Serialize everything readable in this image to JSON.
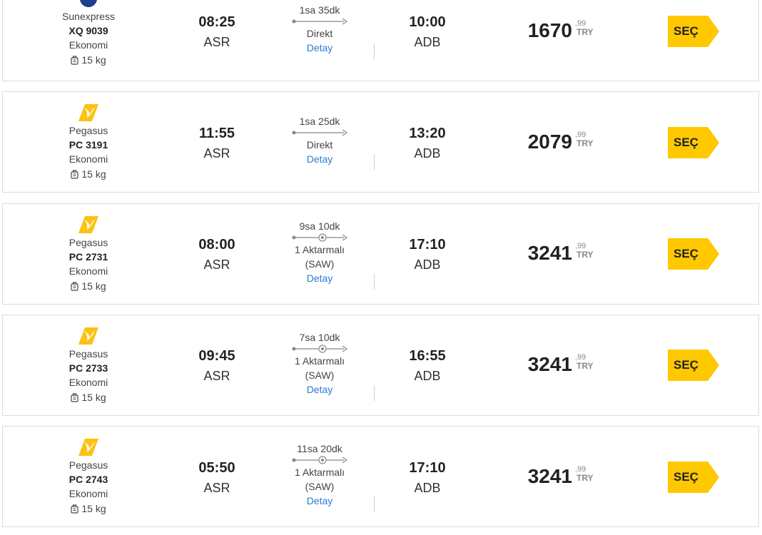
{
  "colors": {
    "accent": "#ffc800",
    "link": "#2b7ad6",
    "border": "#dcdcdc"
  },
  "flights": [
    {
      "airline": "Sunexpress",
      "logo_icon": "sunexpress-logo-icon",
      "flight_no": "XQ 9039",
      "cabin": "Ekonomi",
      "baggage": "15 kg",
      "dep_time": "08:25",
      "dep_airport": "ASR",
      "duration": "1sa 35dk",
      "stop_text": "Direkt",
      "stop_airport": "",
      "detail_label": "Detay",
      "arr_time": "10:00",
      "arr_airport": "ADB",
      "price_int": "1670",
      "price_frac": ",99",
      "currency": "TRY",
      "select_label": "SEÇ"
    },
    {
      "airline": "Pegasus",
      "logo_icon": "pegasus-logo-icon",
      "flight_no": "PC 3191",
      "cabin": "Ekonomi",
      "baggage": "15 kg",
      "dep_time": "11:55",
      "dep_airport": "ASR",
      "duration": "1sa 25dk",
      "stop_text": "Direkt",
      "stop_airport": "",
      "detail_label": "Detay",
      "arr_time": "13:20",
      "arr_airport": "ADB",
      "price_int": "2079",
      "price_frac": ",99",
      "currency": "TRY",
      "select_label": "SEÇ"
    },
    {
      "airline": "Pegasus",
      "logo_icon": "pegasus-logo-icon",
      "flight_no": "PC 2731",
      "cabin": "Ekonomi",
      "baggage": "15 kg",
      "dep_time": "08:00",
      "dep_airport": "ASR",
      "duration": "9sa 10dk",
      "stop_text": "1 Aktarmalı",
      "stop_airport": "(SAW)",
      "detail_label": "Detay",
      "arr_time": "17:10",
      "arr_airport": "ADB",
      "price_int": "3241",
      "price_frac": ",99",
      "currency": "TRY",
      "select_label": "SEÇ"
    },
    {
      "airline": "Pegasus",
      "logo_icon": "pegasus-logo-icon",
      "flight_no": "PC 2733",
      "cabin": "Ekonomi",
      "baggage": "15 kg",
      "dep_time": "09:45",
      "dep_airport": "ASR",
      "duration": "7sa 10dk",
      "stop_text": "1 Aktarmalı",
      "stop_airport": "(SAW)",
      "detail_label": "Detay",
      "arr_time": "16:55",
      "arr_airport": "ADB",
      "price_int": "3241",
      "price_frac": ",99",
      "currency": "TRY",
      "select_label": "SEÇ"
    },
    {
      "airline": "Pegasus",
      "logo_icon": "pegasus-logo-icon",
      "flight_no": "PC 2743",
      "cabin": "Ekonomi",
      "baggage": "15 kg",
      "dep_time": "05:50",
      "dep_airport": "ASR",
      "duration": "11sa 20dk",
      "stop_text": "1 Aktarmalı",
      "stop_airport": "(SAW)",
      "detail_label": "Detay",
      "arr_time": "17:10",
      "arr_airport": "ADB",
      "price_int": "3241",
      "price_frac": ",99",
      "currency": "TRY",
      "select_label": "SEÇ"
    }
  ]
}
